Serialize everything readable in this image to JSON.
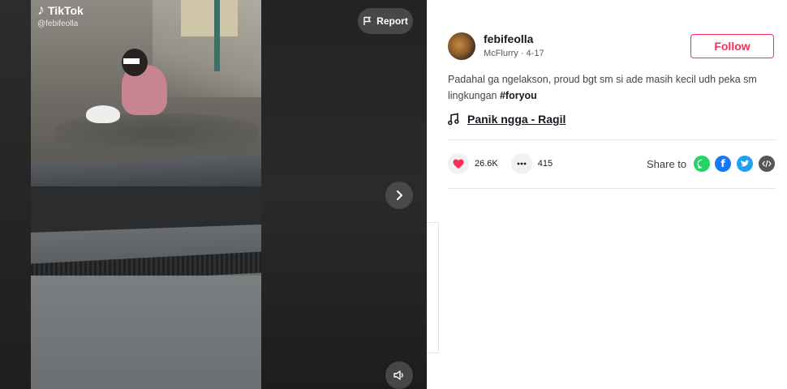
{
  "player": {
    "brand": "TikTok",
    "handle_watermark": "@febifeolla",
    "report_label": "Report"
  },
  "author": {
    "username": "febifeolla",
    "subtitle": "McFlurry · 4-17",
    "follow_label": "Follow"
  },
  "caption": {
    "text": "Padahal ga ngelakson, proud bgt sm si ade masih kecil udh peka sm lingkungan",
    "hashtag": "#foryou"
  },
  "music": {
    "title": "Panik ngga - Ragil"
  },
  "stats": {
    "likes": "26.6K",
    "comments": "415"
  },
  "share": {
    "label": "Share to",
    "targets": [
      "whatsapp-icon",
      "facebook-icon",
      "twitter-icon",
      "embed-icon"
    ]
  },
  "colors": {
    "accent": "#fe2c55",
    "whatsapp": "#25d366",
    "facebook": "#1877f2",
    "twitter": "#1da1f2",
    "embed": "#555555"
  }
}
